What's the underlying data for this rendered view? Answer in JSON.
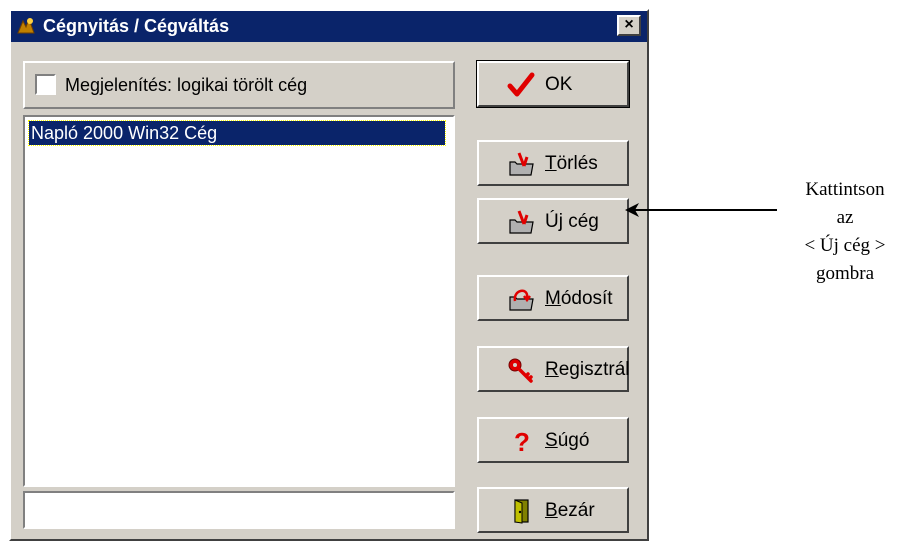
{
  "window": {
    "title": "Cégnyitás / Cégváltás",
    "title_bg": "#0a246a",
    "close_label": "×"
  },
  "options": {
    "show_deleted_label": "Megjelenítés: logikai törölt cég",
    "show_deleted_checked": false
  },
  "company_list": {
    "items": [
      "Napló 2000 Win32 Cég"
    ],
    "selected_index": 0
  },
  "text_field": {
    "value": ""
  },
  "buttons": {
    "ok": "OK",
    "delete": "Törlés",
    "new_company": "Új cég",
    "modify": "Módosít",
    "register": "Regisztrál",
    "help": "Súgó",
    "close": "Bezár"
  },
  "annotation": {
    "lines": [
      "Kattintson",
      "az",
      "< Új cég >",
      "gombra"
    ]
  }
}
